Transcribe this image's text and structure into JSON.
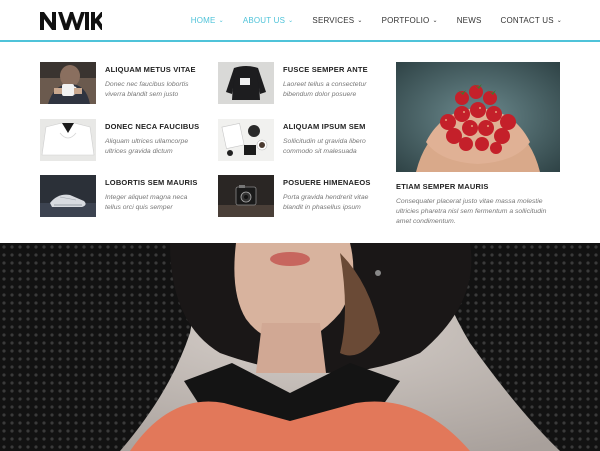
{
  "brand": {
    "logo": "NWIK"
  },
  "nav": [
    {
      "label": "HOME",
      "dropdown": true,
      "active": true
    },
    {
      "label": "ABOUT US",
      "dropdown": true,
      "active": true
    },
    {
      "label": "SERVICES",
      "dropdown": true
    },
    {
      "label": "PORTFOLIO",
      "dropdown": true
    },
    {
      "label": "NEWS",
      "dropdown": false
    },
    {
      "label": "CONTACT US",
      "dropdown": true
    }
  ],
  "accent_color": "#4fc3d9",
  "mega_menu": {
    "col1": [
      {
        "title": "ALIQUAM METUS VITAE",
        "desc": "Donec nec faucibus lobortis viverra blandit sem justo",
        "image": "woman-with-mug"
      },
      {
        "title": "DONEC NECA FAUCIBUS",
        "desc": "Aliquam ultrices ullamcorpe ultrices gravida dictum",
        "image": "white-shirt"
      },
      {
        "title": "LOBORTIS SEM MAURIS",
        "desc": "Integer aliquet magna neca tellus orci quis semper",
        "image": "sneakers"
      }
    ],
    "col2": [
      {
        "title": "FUSCE SEMPER ANTE",
        "desc": "Laoreet tellus a consectetur bibendum dolor posuere",
        "image": "black-sweater"
      },
      {
        "title": "ALIQUAM IPSUM SEM",
        "desc": "Sollicitudin ut gravida libero commodo sit malesuada",
        "image": "desk-flatlay"
      },
      {
        "title": "POSUERE HIMENAEOS",
        "desc": "Porta gravida hendrerit vitae blandit in phasellus ipsum",
        "image": "vintage-camera"
      }
    ],
    "feature": {
      "title": "ETIAM SEMPER MAURIS",
      "desc": "Consequater placerat justo vitae massa molestie ultricies pharetra nisl sem fermentum a sollicitudin amet condimentum.",
      "image": "strawberries-in-hands"
    }
  },
  "hero": {
    "image": "woman-in-black-hat"
  }
}
